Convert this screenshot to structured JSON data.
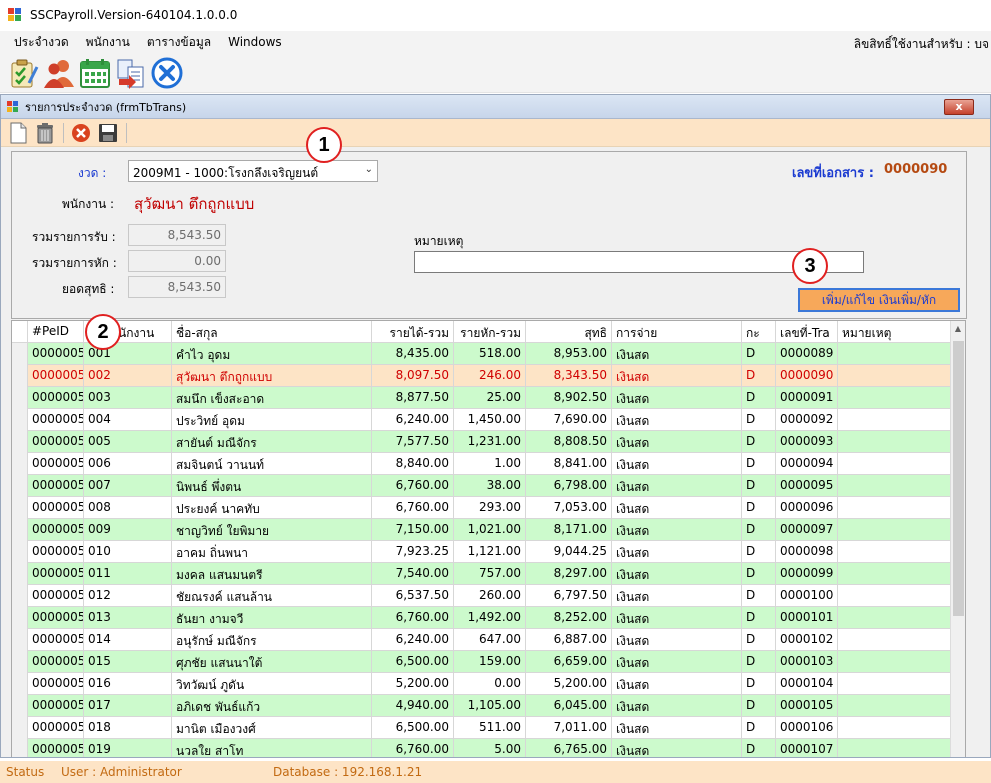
{
  "window": {
    "title": "SSCPayroll.Version-640104.1.0.0.0"
  },
  "menu": {
    "items": [
      "ประจำงวด",
      "พนักงาน",
      "ตารางข้อมูล",
      "Windows"
    ],
    "right_text": "ลิขสิทธิ์ใช้งานสำหรับ : บจ"
  },
  "toolbar": {
    "icons": [
      "checklist-icon",
      "users-icon",
      "calendar-icon",
      "import-icon",
      "close-circle-icon"
    ]
  },
  "child": {
    "title": "รายการประจำงวด (frmTbTrans)",
    "close_label": "x"
  },
  "form": {
    "period_label": "งวด :",
    "period_value": "2009M1 - 1000:โรงกลึงเจริญยนต์",
    "doc_no_label": "เลขที่เอกสาร :",
    "doc_no_value": "0000090",
    "employee_label": "พนักงาน :",
    "employee_value": "สุวัฒนา    ตึกถูกแบบ",
    "income_label": "รวมรายการรับ :",
    "income_value": "8,543.50",
    "deduct_label": "รวมรายการหัก :",
    "deduct_value": "0.00",
    "net_label": "ยอดสุทธิ :",
    "net_value": "8,543.50",
    "note_label": "หมายเหตุ",
    "note_value": "",
    "action_button": "เพิ่ม/แก้ไข เงินเพิ่ม/หัก"
  },
  "markers": [
    "1",
    "2",
    "3"
  ],
  "grid": {
    "columns": [
      "#PeID",
      "ชื่อ-สกุล",
      "รายได้-รวม",
      "รายหัก-รวม",
      "สุทธิ",
      "การจ่าย",
      "กะ",
      "เลขที่-Tra",
      "หมายเหตุ"
    ],
    "column_partial": "นักงาน",
    "rows": [
      [
        "0000005",
        "001",
        "คำไว อุดม",
        "8,435.00",
        "518.00",
        "8,953.00",
        "เงินสด",
        "D",
        "0000089"
      ],
      [
        "0000005",
        "002",
        "สุวัฒนา    ตึกถูกแบบ",
        "8,097.50",
        "246.00",
        "8,343.50",
        "เงินสด",
        "D",
        "0000090"
      ],
      [
        "0000005",
        "003",
        "สมนึก เข็งสะอาด",
        "8,877.50",
        "25.00",
        "8,902.50",
        "เงินสด",
        "D",
        "0000091"
      ],
      [
        "0000005",
        "004",
        "ประวิทย์ อุดม",
        "6,240.00",
        "1,450.00",
        "7,690.00",
        "เงินสด",
        "D",
        "0000092"
      ],
      [
        "0000005",
        "005",
        "สายันต์ มณีจักร",
        "7,577.50",
        "1,231.00",
        "8,808.50",
        "เงินสด",
        "D",
        "0000093"
      ],
      [
        "0000005",
        "006",
        "สมจินตน์ วานนท์",
        "8,840.00",
        "1.00",
        "8,841.00",
        "เงินสด",
        "D",
        "0000094"
      ],
      [
        "0000005",
        "007",
        "นิพนธ์   พึ่งตน",
        "6,760.00",
        "38.00",
        "6,798.00",
        "เงินสด",
        "D",
        "0000095"
      ],
      [
        "0000005",
        "008",
        "ประยงค์ นาคทับ",
        "6,760.00",
        "293.00",
        "7,053.00",
        "เงินสด",
        "D",
        "0000096"
      ],
      [
        "0000005",
        "009",
        "ชาญวิทย์ ใยพิมาย",
        "7,150.00",
        "1,021.00",
        "8,171.00",
        "เงินสด",
        "D",
        "0000097"
      ],
      [
        "0000005",
        "010",
        "อาคม ถิ่นพนา",
        "7,923.25",
        "1,121.00",
        "9,044.25",
        "เงินสด",
        "D",
        "0000098"
      ],
      [
        "0000005",
        "011",
        "มงคล แสนมนตรี",
        "7,540.00",
        "757.00",
        "8,297.00",
        "เงินสด",
        "D",
        "0000099"
      ],
      [
        "0000005",
        "012",
        "ชัยณรงค์ แสนล้าน",
        "6,537.50",
        "260.00",
        "6,797.50",
        "เงินสด",
        "D",
        "0000100"
      ],
      [
        "0000005",
        "013",
        "ธันยา งามจวี",
        "6,760.00",
        "1,492.00",
        "8,252.00",
        "เงินสด",
        "D",
        "0000101"
      ],
      [
        "0000005",
        "014",
        "อนุรักษ์ มณีจักร",
        "6,240.00",
        "647.00",
        "6,887.00",
        "เงินสด",
        "D",
        "0000102"
      ],
      [
        "0000005",
        "015",
        "ศุภชัย แสนนาใต้",
        "6,500.00",
        "159.00",
        "6,659.00",
        "เงินสด",
        "D",
        "0000103"
      ],
      [
        "0000005",
        "016",
        "วิทวัฒน์ ภูดัน",
        "5,200.00",
        "0.00",
        "5,200.00",
        "เงินสด",
        "D",
        "0000104"
      ],
      [
        "0000005",
        "017",
        "อภิเดช พันธ์แก้ว",
        "4,940.00",
        "1,105.00",
        "6,045.00",
        "เงินสด",
        "D",
        "0000105"
      ],
      [
        "0000005",
        "018",
        "มานิต เมืองวงศ์",
        "6,500.00",
        "511.00",
        "7,011.00",
        "เงินสด",
        "D",
        "0000106"
      ],
      [
        "0000005",
        "019",
        "นวลใย สาโท",
        "6,760.00",
        "5.00",
        "6,765.00",
        "เงินสด",
        "D",
        "0000107"
      ]
    ],
    "selected_row": 1
  },
  "status": {
    "status": "Status",
    "user": "User : Administrator",
    "database": "Database : 192.168.1.21"
  },
  "colors": {
    "row_green": "#ccfacc",
    "row_selected": "#fde4c6",
    "selected_text": "#d00000",
    "label_blue": "#1b3bd1",
    "employee_red": "#c00000",
    "marker_red": "#e02020"
  }
}
